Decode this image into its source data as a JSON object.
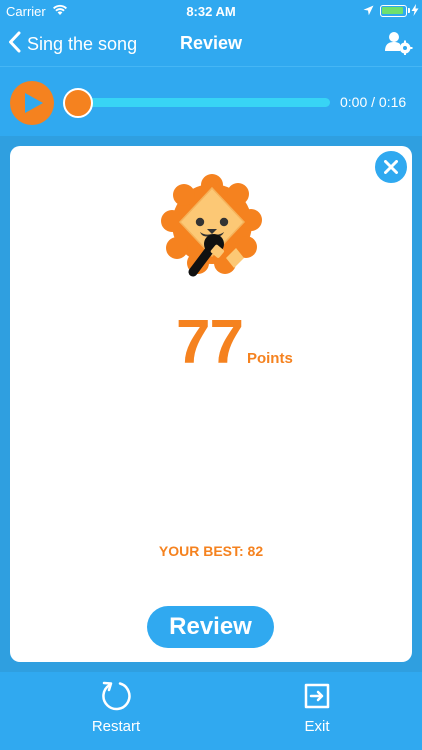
{
  "status_bar": {
    "carrier": "Carrier",
    "time": "8:32 AM",
    "battery_color": "#6ee06e"
  },
  "nav": {
    "back_label": "Sing the song",
    "title": "Review",
    "settings_icon": "user-settings-icon"
  },
  "player": {
    "time_readout": "0:00 / 0:16",
    "progress": 0,
    "accent_color": "#f5821f",
    "track_color": "#38d4f5"
  },
  "result": {
    "score": "77",
    "score_unit": "Points",
    "best_label": "YOUR BEST: 82",
    "review_label": "Review",
    "mascot_icon": "singing-lion-icon"
  },
  "bottom_bar": {
    "restart_label": "Restart",
    "exit_label": "Exit"
  },
  "colors": {
    "brand_blue": "#30a9f0",
    "accent_orange": "#f5821f"
  }
}
